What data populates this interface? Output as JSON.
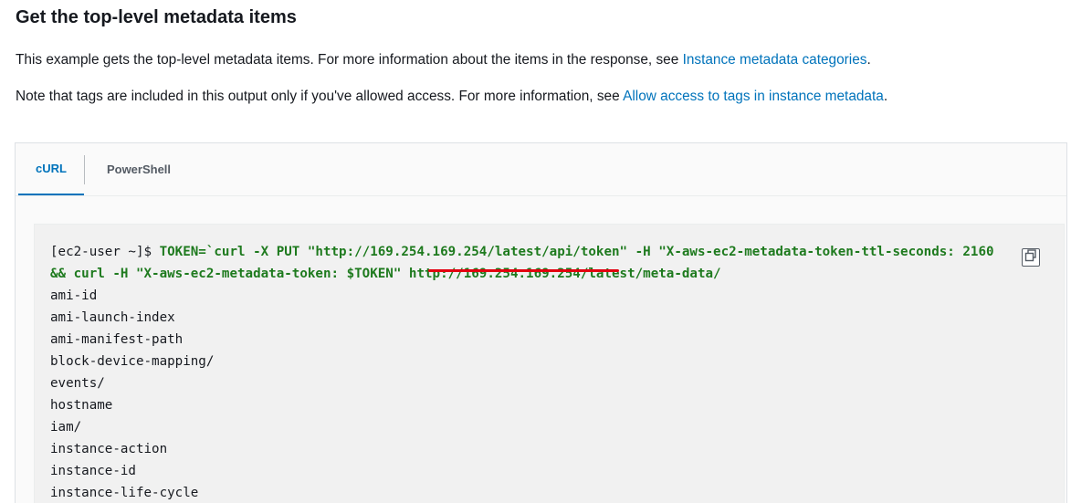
{
  "heading": "Get the top-level metadata items",
  "paragraph1": {
    "text": "This example gets the top-level metadata items. For more information about the items in the response, see ",
    "link": "Instance metadata categories",
    "suffix": "."
  },
  "paragraph2": {
    "text": "Note that tags are included in this output only if you've allowed access. For more information, see ",
    "link": "Allow access to tags in instance metadata",
    "suffix": "."
  },
  "tabs": [
    {
      "label": "cURL",
      "active": true
    },
    {
      "label": "PowerShell",
      "active": false
    }
  ],
  "code": {
    "prompt": "[ec2-user ~]$ ",
    "command_line1": "TOKEN=`curl -X PUT \"http://169.254.169.254/latest/api/token\" -H \"X-aws-ec2-metadata-token-ttl-seconds: 2160",
    "command_line2_pre": "&& curl -H \"X-aws-ec2-metadata-token: $TOKEN\" ",
    "command_line2_url": "http://169.254.169.254/latest/meta-data/",
    "output_lines": [
      "ami-id",
      "ami-launch-index",
      "ami-manifest-path",
      "block-device-mapping/",
      "events/",
      "hostname",
      "iam/",
      "instance-action",
      "instance-id",
      "instance-life-cycle"
    ]
  },
  "icons": {
    "copy": "copy-icon"
  },
  "colors": {
    "link": "#0073bb",
    "command": "#1e7a1e",
    "highlight_underline": "#e3000f"
  }
}
